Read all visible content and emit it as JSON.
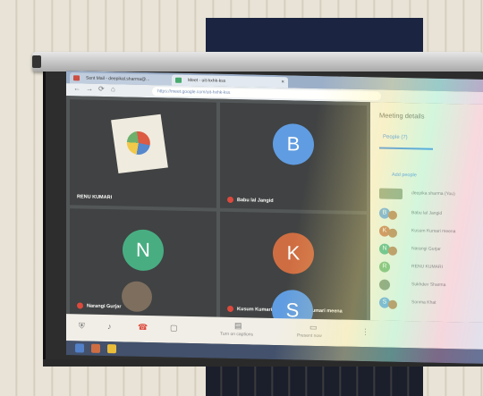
{
  "browser": {
    "tabs": [
      {
        "label": "Sent Mail - deepikal.sharma@...",
        "close": "×"
      },
      {
        "label": "Meet - uit-hxhk-kss",
        "close": "×"
      }
    ],
    "url": "https://meet.google.com/uit-hxhk-kss",
    "nav": {
      "back": "←",
      "forward": "→",
      "reload": "⟳",
      "home": "⌂"
    }
  },
  "meet": {
    "tiles": [
      {
        "name": "RENU KUMARI",
        "avatar_letter": "",
        "color": ""
      },
      {
        "name": "Babu lal Jangid",
        "avatar_letter": "B",
        "color": "#4a8fe0"
      },
      {
        "name": "Narangi Gurjar",
        "avatar_letter": "N",
        "color": "#2fa374"
      },
      {
        "name": "Kusum Kumari meena Kusum Kumari meena",
        "avatar_letter": "K",
        "color": "#c9592b"
      },
      {
        "name": "",
        "avatar_letter": "",
        "color": ""
      },
      {
        "name": "",
        "avatar_letter": "S",
        "color": "#4a8fe0"
      }
    ]
  },
  "side": {
    "title": "Meeting details",
    "people_tab": "People (7)",
    "add_people": "Add people",
    "participants": [
      {
        "letter": "",
        "name": "deepika sharma (You)",
        "color": "#7a8a6a"
      },
      {
        "letter": "B",
        "name": "Babu lal Jangid",
        "color": "#4a8fe0"
      },
      {
        "letter": "K",
        "name": "Kusum Kumari meena",
        "color": "#c9592b"
      },
      {
        "letter": "N",
        "name": "Narangi Gurjar",
        "color": "#2fa374"
      },
      {
        "letter": "R",
        "name": "RENU KUMARI",
        "color": "#5aa55a"
      },
      {
        "letter": "",
        "name": "Sukhdev Sharma",
        "color": "#6a7a5a"
      },
      {
        "letter": "S",
        "name": "Sonma Khat",
        "color": "#4a8fe0"
      }
    ]
  },
  "controls": {
    "captions": "Turn on captions",
    "present": "Present now"
  }
}
